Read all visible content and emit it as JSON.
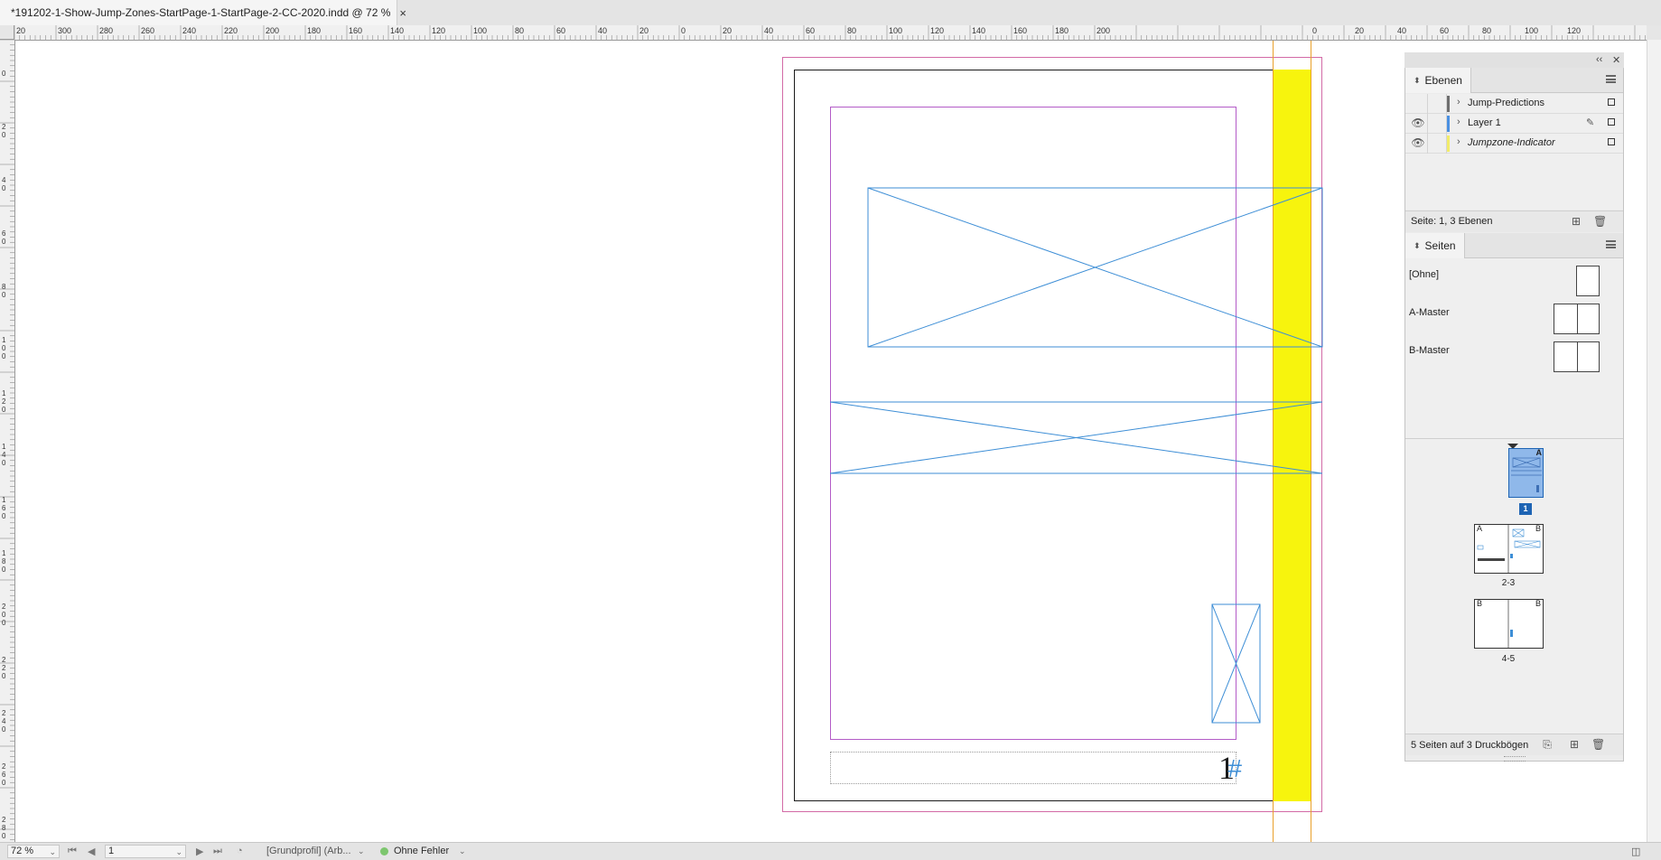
{
  "document": {
    "tab_title": "*191202-1-Show-Jump-Zones-StartPage-1-StartPage-2-CC-2020.indd @ 72 %",
    "close_glyph": "×"
  },
  "rulers": {
    "top_labels_left": [
      "20",
      "300",
      "280",
      "260",
      "240",
      "220",
      "200",
      "180",
      "160",
      "140",
      "120",
      "100",
      "80",
      "60",
      "40",
      "20",
      "0",
      "20",
      "40",
      "60",
      "80",
      "100",
      "120",
      "140",
      "160",
      "180",
      "200"
    ],
    "top_labels_right": [
      "0",
      "20",
      "40",
      "60",
      "80",
      "100",
      "120"
    ],
    "left_labels": [
      "0",
      "2 0",
      "4 0",
      "6 0",
      "8 0",
      "1 0 0",
      "1 2 0",
      "1 4 0",
      "1 6 0",
      "1 8 0",
      "2 0 0",
      "2 2 0",
      "2 4 0",
      "2 6 0",
      "2 8 0"
    ]
  },
  "canvas": {
    "page_number_text": "1",
    "page_marker_text": "#",
    "yellow_color": "#f7f40d",
    "frame_color": "#3d8ed6",
    "margin_color": "#b35bc7",
    "bleed_color": "#d36aa6",
    "guide_color": "#e9a02b"
  },
  "layers_panel": {
    "tab_label": "Ebenen",
    "layers": [
      {
        "name": "Jump-Predictions",
        "visible": false,
        "color": "#6e6e6e",
        "locked_pen": false,
        "italic": false
      },
      {
        "name": "Layer 1",
        "visible": true,
        "color": "#4a90e2",
        "locked_pen": true,
        "italic": false
      },
      {
        "name": "Jumpzone-Indicator",
        "visible": true,
        "color": "#f2ec6a",
        "locked_pen": false,
        "italic": true
      }
    ],
    "status": "Seite: 1, 3 Ebenen"
  },
  "pages_panel": {
    "tab_label": "Seiten",
    "masters": [
      {
        "label": "[Ohne]",
        "type": "single"
      },
      {
        "label": "A-Master",
        "type": "double"
      },
      {
        "label": "B-Master",
        "type": "double"
      }
    ],
    "page1_badge": "1",
    "page1_master": "A",
    "spread2_label": "2-3",
    "spread2_masters": [
      "A",
      "B"
    ],
    "spread3_label": "4-5",
    "spread3_masters": [
      "B",
      "B"
    ],
    "status": "5 Seiten auf 3 Druckbögen"
  },
  "statusbar": {
    "zoom": "72 %",
    "page": "1",
    "profile": "[Grundprofil] (Arb...",
    "preflight": "Ohne Fehler",
    "preflight_color": "#7dc66e"
  }
}
